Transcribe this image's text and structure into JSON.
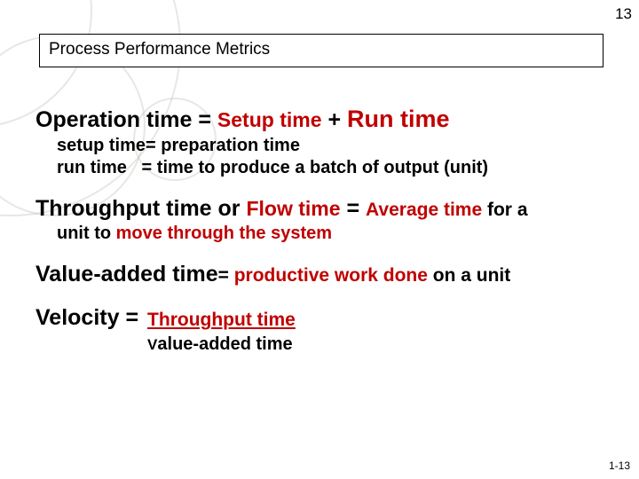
{
  "page_number_top": "13",
  "page_number_bottom": "1-13",
  "title": "Process Performance Metrics",
  "op": {
    "lhs": "Operation time = ",
    "setup": "Setup time",
    "plus": " + ",
    "run": "Run time",
    "sub1_a": "setup time= preparation time",
    "sub2_label": "run time",
    "sub2_eq": "   = time to produce a batch of output (unit)"
  },
  "thr": {
    "a": "Throughput time or ",
    "flow": "Flow time",
    "b": " = ",
    "avg": "Average time",
    "c": " for a",
    "sub_a": "unit to ",
    "sub_red": "move through the system"
  },
  "va": {
    "a": "Value-added time",
    "b": "= ",
    "red": "productive work done",
    "c": " on a unit"
  },
  "vel": {
    "a": "Velocity = ",
    "num": "Throughput time",
    "den_v": "V",
    "den_rest": "alue-added time"
  }
}
